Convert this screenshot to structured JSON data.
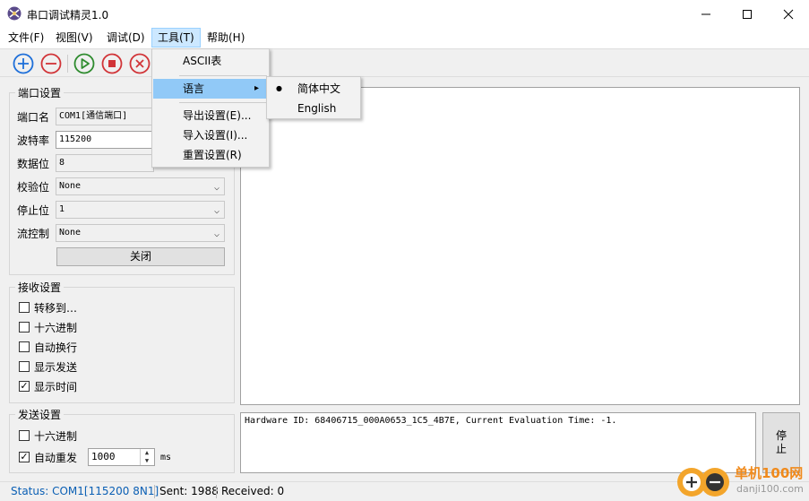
{
  "window": {
    "title": "串口调试精灵1.0",
    "minimize": "—",
    "maximize": "☐",
    "close": "✕"
  },
  "menubar": {
    "items": [
      "文件(F)",
      "视图(V)",
      "调试(D)",
      "工具(T)",
      "帮助(H)"
    ]
  },
  "toolbar": {
    "icons": [
      "add-icon",
      "remove-icon",
      "play-icon",
      "stop-icon",
      "cancel-icon"
    ]
  },
  "tools_menu": {
    "items": [
      "ASCII表",
      "语言",
      "导出设置(E)...",
      "导入设置(I)...",
      "重置设置(R)"
    ],
    "submenu_arrow": "▸"
  },
  "language_menu": {
    "items": [
      "简体中文",
      "English"
    ],
    "selected_marker": "●"
  },
  "port_settings": {
    "title": "端口设置",
    "port_label": "端口名",
    "port_value": "COM1[通信端口]",
    "baud_label": "波特率",
    "baud_value": "115200",
    "databits_label": "数据位",
    "databits_value": "8",
    "parity_label": "校验位",
    "parity_value": "None",
    "stopbits_label": "停止位",
    "stopbits_value": "1",
    "flow_label": "流控制",
    "flow_value": "None",
    "close_button": "关闭"
  },
  "receive_settings": {
    "title": "接收设置",
    "options": [
      {
        "label": "转移到…",
        "checked": false
      },
      {
        "label": "十六进制",
        "checked": false
      },
      {
        "label": "自动换行",
        "checked": false
      },
      {
        "label": "显示发送",
        "checked": false
      },
      {
        "label": "显示时间",
        "checked": true
      }
    ]
  },
  "send_settings": {
    "title": "发送设置",
    "hex_label": "十六进制",
    "hex_checked": false,
    "auto_resend_label": "自动重发",
    "auto_resend_checked": true,
    "interval_value": "1000",
    "interval_unit": "ms"
  },
  "send_box": {
    "text": "Hardware ID: 68406715_000A0653_1C5_4B7E, Current Evaluation Time: -1.",
    "send_button": "停\n止"
  },
  "statusbar": {
    "status": "Status: COM1[115200 8N1]",
    "sent": "Sent: 1988",
    "received": "Received: 0"
  },
  "watermark": {
    "site_name": "单机100网",
    "site_url": "danji100.com"
  },
  "colors": {
    "blue": "#1e6fd9",
    "red": "#d13438",
    "green": "#2e8b2e",
    "status_blue": "#0a5fb4",
    "highlight": "#91c9f7"
  }
}
